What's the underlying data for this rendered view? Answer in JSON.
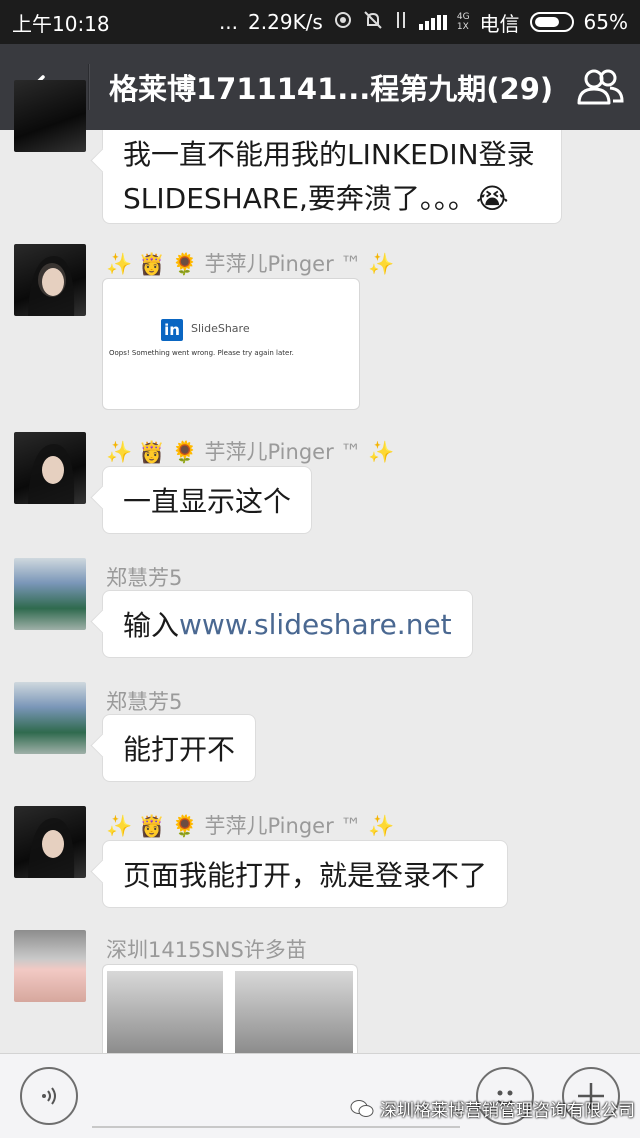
{
  "status_bar": {
    "time": "上午10:18",
    "dots": "...",
    "speed": "2.29K/s",
    "network": "4G",
    "network_sub": "1X",
    "carrier": "电信",
    "battery": "65%"
  },
  "header": {
    "title": "格莱博1711141...程第九期(29)"
  },
  "messages": [
    {
      "text_line1": "我一直不能用我的LINKEDIN登录",
      "text_line2": "SLIDESHARE,要奔溃了。。。😭"
    },
    {
      "sender": "✨ 👸 🌻 芋萍儿Pinger ™ ✨",
      "image": {
        "logo": "in",
        "brand": "SlideShare",
        "error": "Oops! Something went wrong. Please try again later."
      }
    },
    {
      "sender": "✨ 👸 🌻 芋萍儿Pinger ™ ✨",
      "text": "一直显示这个"
    },
    {
      "sender": "郑慧芳5",
      "text_prefix": "输入",
      "link": "www.slideshare.net"
    },
    {
      "sender": "郑慧芳5",
      "text": "能打开不"
    },
    {
      "sender": "✨ 👸 🌻 芋萍儿Pinger ™ ✨",
      "text": "页面我能打开，就是登录不了"
    },
    {
      "sender": "深圳1415SNS许多苗"
    }
  ],
  "watermark": "深圳格莱博营销管理咨询有限公司",
  "colors": {
    "header_bg": "#393a3f",
    "chat_bg": "#ebebeb",
    "link": "#4a6891"
  }
}
